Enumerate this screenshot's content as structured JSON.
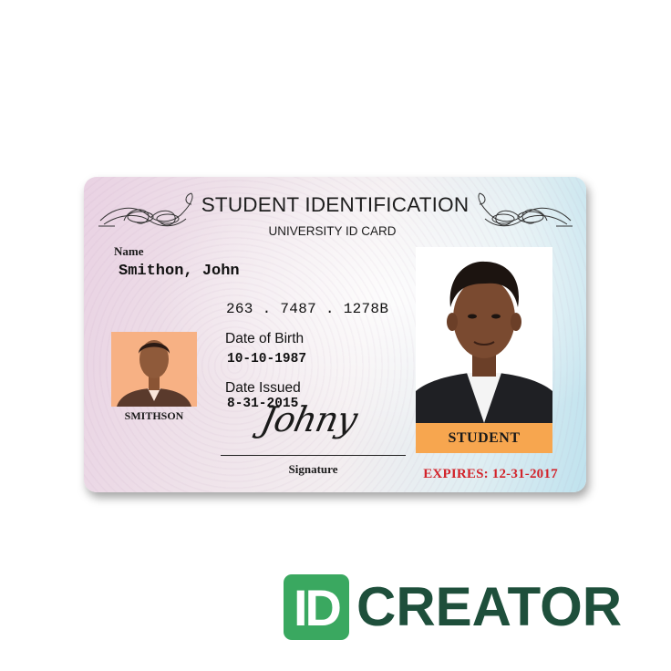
{
  "card": {
    "title": "STUDENT IDENTIFICATION",
    "subtitle": "UNIVERSITY ID CARD",
    "name_label": "Name",
    "name_value": "Smithon, John",
    "id_number": "263 . 7487 . 1278B",
    "dob_label": "Date of Birth",
    "dob_value": "10-10-1987",
    "issued_label": "Date Issued",
    "issued_value": "8-31-2015",
    "signature_text": "Johny",
    "signature_label": "Signature",
    "small_photo_caption": "SMITHSON",
    "role_badge": "STUDENT",
    "expires": "EXPIRES: 12-31-2017"
  },
  "logo": {
    "box_text": "ID",
    "word": "CREATOR"
  },
  "colors": {
    "expires_red": "#d2232a",
    "badge_orange": "#f7a64f",
    "small_photo_bg": "#f7b184",
    "logo_green": "#3aa860",
    "logo_dark": "#1e4f3b"
  }
}
